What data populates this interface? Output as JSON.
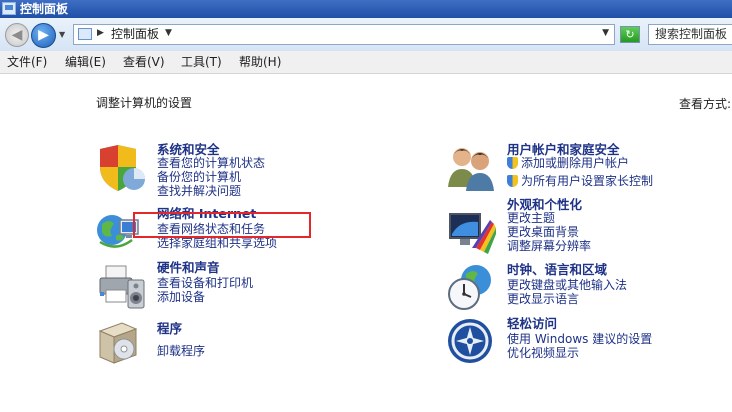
{
  "window": {
    "title": "控制面板"
  },
  "address": {
    "crumb": "控制面板",
    "search_placeholder": "搜索控制面板"
  },
  "menu": [
    "文件(F)",
    "编辑(E)",
    "查看(V)",
    "工具(T)",
    "帮助(H)"
  ],
  "content": {
    "heading": "调整计算机的设置",
    "view_by_label": "查看方式:"
  },
  "categories": {
    "system_security": {
      "title": "系统和安全",
      "links": [
        "查看您的计算机状态",
        "备份您的计算机",
        "查找并解决问题"
      ]
    },
    "network": {
      "title": "网络和 Internet",
      "links": [
        "查看网络状态和任务",
        "选择家庭组和共享选项"
      ]
    },
    "hardware": {
      "title": "硬件和声音",
      "links": [
        "查看设备和打印机",
        "添加设备"
      ]
    },
    "programs": {
      "title": "程序",
      "links": [
        "卸载程序"
      ]
    },
    "user_accounts": {
      "title": "用户帐户和家庭安全",
      "links": [
        "添加或删除用户帐户",
        "为所有用户设置家长控制"
      ]
    },
    "appearance": {
      "title": "外观和个性化",
      "links": [
        "更改主题",
        "更改桌面背景",
        "调整屏幕分辨率"
      ]
    },
    "clock": {
      "title": "时钟、语言和区域",
      "links": [
        "更改键盘或其他输入法",
        "更改显示语言"
      ]
    },
    "ease": {
      "title": "轻松访问",
      "links": [
        "使用 Windows 建议的设置",
        "优化视频显示"
      ]
    }
  },
  "colors": {
    "link": "#1e3287",
    "highlight_box": "#e3272a"
  }
}
